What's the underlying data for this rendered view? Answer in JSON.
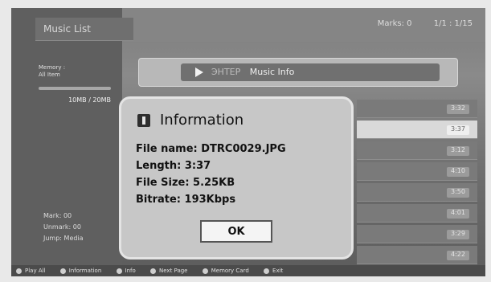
{
  "screen": {
    "left_panel": {
      "title": "Music List",
      "info_line1": "Memory :",
      "info_line2": "All Item",
      "used": "10MB / 20MB",
      "stats": [
        "Mark: 00",
        "Unmark: 00",
        "Jump: Media"
      ]
    },
    "top_bar": {
      "mark": "Marks: 0",
      "page": "1/1 : 1/15"
    },
    "banner": {
      "dim_text": "ЭНТЕР",
      "title": "Music Info"
    },
    "list_rows": [
      {
        "value": "3:32"
      },
      {
        "value": "3:37"
      },
      {
        "value": "3:12"
      },
      {
        "value": "4:10"
      },
      {
        "value": "3:50"
      },
      {
        "value": "4:01"
      },
      {
        "value": "3:29"
      },
      {
        "value": "4:22"
      }
    ],
    "bottom_bar": [
      {
        "label": "Play All"
      },
      {
        "label": "Information"
      },
      {
        "label": "Info"
      },
      {
        "label": "Next Page"
      },
      {
        "label": "Memory Card"
      },
      {
        "label": "Exit"
      }
    ]
  },
  "dialog": {
    "icon": "info-icon",
    "title": "Information",
    "file_name": "File name: DTRC0029.JPG",
    "length": "Length: 3:37",
    "file_size": "File Size: 5.25KB",
    "bitrate": "Bitrate: 193Kbps",
    "ok_label": "OK"
  }
}
